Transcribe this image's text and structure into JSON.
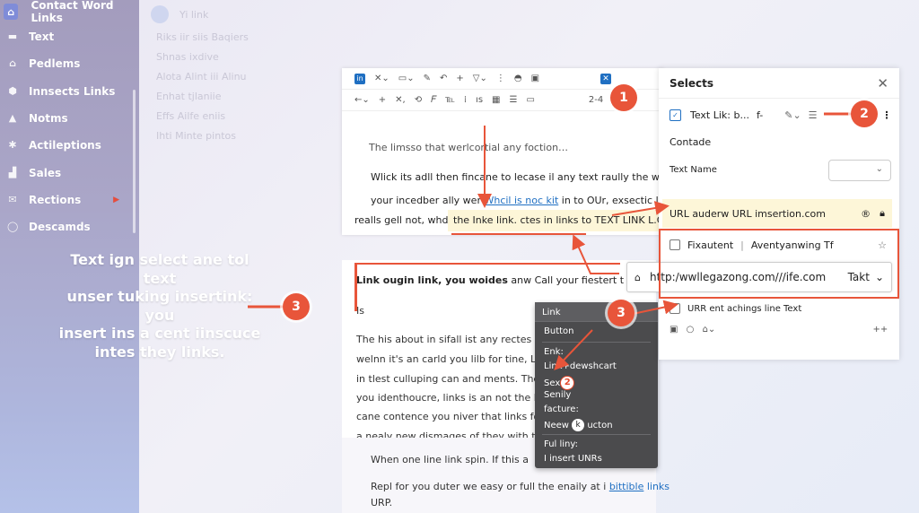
{
  "sidebar": {
    "title": "Contact Word Links",
    "items": [
      {
        "label": "Text",
        "icon": "folder-icon"
      },
      {
        "label": "Pedlems",
        "icon": "building-icon"
      },
      {
        "label": "Innsects Links",
        "icon": "shield-icon"
      },
      {
        "label": "Notms",
        "icon": "person-icon"
      },
      {
        "label": "Actileptions",
        "icon": "star-icon"
      },
      {
        "label": "Sales",
        "icon": "chart-icon"
      },
      {
        "label": "Rections",
        "icon": "mail-icon"
      },
      {
        "label": "Descamds",
        "icon": "chat-icon"
      }
    ],
    "note_lines": [
      "Text ign select ane tol text",
      "unser tuking insertink: you",
      "insert ins a cent iinscuce",
      "intes they links."
    ]
  },
  "faded_menu": {
    "title": "Yi link",
    "rows": [
      "Riks iir siis Baqiers",
      "Shnas ixdive",
      "Alota Alint iii Alinu",
      "Enhat tjlaniie",
      "Effs Ailfe eniis",
      "Ihti Minte pintos"
    ]
  },
  "editor": {
    "line1": "The limsso that werlcortial any foction…",
    "line2": "Wlick its adll then fincane to lecase il any text raully the wes",
    "line3_pre": "your incedber ally wer",
    "line3_link": "Whcil is noc kit",
    "line3_post": "in to OUr, exsectic ly",
    "line4": "realls gell not, whd",
    "highlight": "the Inke link. ctes in links to TEXT LINK L.CU",
    "tb_num": "2-4"
  },
  "doc": {
    "heading_bold": "Link ougin link, you woides",
    "heading_rest": "anw Call your fiestert t",
    "is_label": "Is",
    "lines": [
      "The his about in sifall ist any rectes lin",
      "welnn it's an carld you lilb for tine, Lin",
      "in tlest culluping can and ments. The c",
      "you identhoucre, links is an not the li",
      "cane contence you niver that links for",
      "a nealy new dismages of they with the"
    ],
    "bottom1": "When one line link spin. If this a",
    "bottom2_pre": "Repl for you duter we easy or full the enaily at i",
    "bottom2_link": "bittible",
    "bottom2_post": "links",
    "bottom3": "URP."
  },
  "context_menu": {
    "title": "Link",
    "items": [
      "Button",
      "Enk:",
      "Link+dewshcart",
      "Sex",
      "Senily",
      "facture:",
      "Neew",
      "ucton",
      "Ful liny:",
      "I insert UNRs"
    ]
  },
  "panel": {
    "title": "Selects",
    "text_link_label": "Text Lik:  b...",
    "contade": "Contade",
    "text_name": "Text Name",
    "url_label": "URL auderw URL imsertion.com",
    "fix_label": "Fixautent",
    "fix_value": "Aventyanwing Tf",
    "url_value": "http:/wwllegazong.com///ife.com",
    "takt": "Takt",
    "urr_label": "URR ent achings line Text",
    "plus": "++"
  },
  "callouts": [
    "1",
    "2",
    "3",
    "3",
    "2"
  ],
  "colors": {
    "accent": "#e8553a",
    "link": "#1f6fc2",
    "highlight": "#fdf6d8",
    "menu": "#4b4b4d"
  }
}
